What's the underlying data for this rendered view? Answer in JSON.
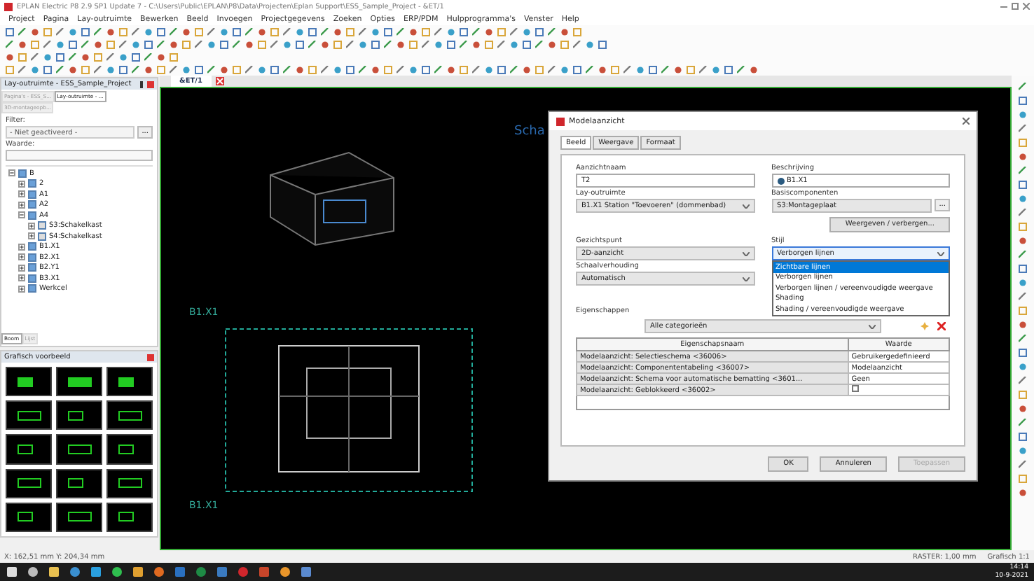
{
  "window": {
    "title": "EPLAN Electric P8 2.9 SP1 Update 7 - C:\\Users\\Public\\EPLAN\\P8\\Data\\Projecten\\Eplan Support\\ESS_Sample_Project - &ET/1"
  },
  "menu": [
    "Project",
    "Pagina",
    "Lay-outruimte",
    "Bewerken",
    "Beeld",
    "Invoegen",
    "Projectgegevens",
    "Zoeken",
    "Opties",
    "ERP/PDM",
    "Hulpprogramma's",
    "Venster",
    "Help"
  ],
  "layout_panel": {
    "title": "Lay-outruimte - ESS_Sample_Project",
    "tabs": [
      {
        "label": "Pagina's - ESS_S...",
        "selected": false
      },
      {
        "label": "Lay-outruimte - ...",
        "selected": true
      },
      {
        "label": "3D-montageopb...",
        "selected": false
      }
    ],
    "filter_label": "Filter:",
    "filter_value": "- Niet geactiveerd -",
    "filter_button": "...",
    "value_label": "Waarde:",
    "tree": [
      {
        "label": "B",
        "expanded": true,
        "children": [
          {
            "label": "2",
            "expanded": false
          },
          {
            "label": "A1",
            "expanded": false
          },
          {
            "label": "A2",
            "expanded": false
          },
          {
            "label": "A4",
            "expanded": true,
            "children": [
              {
                "label": "S3:Schakelkast",
                "expanded": false
              },
              {
                "label": "S4:Schakelkast",
                "expanded": false
              }
            ]
          },
          {
            "label": "B1.X1",
            "expanded": false
          },
          {
            "label": "B2.X1",
            "expanded": false
          },
          {
            "label": "B2.Y1",
            "expanded": false
          },
          {
            "label": "B3.X1",
            "expanded": false
          },
          {
            "label": "Werkcel",
            "expanded": false
          }
        ]
      }
    ],
    "bottom_tabs": [
      {
        "label": "Boom",
        "selected": true
      },
      {
        "label": "Lijst",
        "selected": false
      }
    ]
  },
  "preview_panel": {
    "title": "Grafisch voorbeeld"
  },
  "document_tab": {
    "label": "&ET/1"
  },
  "canvas": {
    "heading": "Scha",
    "marker_top": "B1.X1",
    "marker_bottom": "B1.X1"
  },
  "dialog": {
    "title": "Modelaanzicht",
    "tabs": [
      {
        "label": "Beeld",
        "selected": true
      },
      {
        "label": "Weergave",
        "selected": false
      },
      {
        "label": "Formaat",
        "selected": false
      }
    ],
    "view_name_label": "Aanzichtnaam",
    "view_name": "T2",
    "description_label": "Beschrijving",
    "description": "B1.X1",
    "layout_label": "Lay-outruimte",
    "layout_value": "B1.X1 Station \"Toevoeren\" (dommenbad)",
    "base_label": "Basiscomponenten",
    "base_value": "S3:Montageplaat",
    "base_button": "...",
    "show_hide_button": "Weergeven / verbergen...",
    "viewpoint_label": "Gezichtspunt",
    "viewpoint_value": "2D-aanzicht",
    "style_label": "Stijl",
    "style_value": "Verborgen lijnen",
    "style_options": [
      {
        "label": "Zichtbare lijnen",
        "selected": true
      },
      {
        "label": "Verborgen lijnen",
        "selected": false
      },
      {
        "label": "Verborgen lijnen / vereenvoudigde weergave",
        "selected": false
      },
      {
        "label": "Shading",
        "selected": false
      },
      {
        "label": "Shading / vereenvoudigde weergave",
        "selected": false
      }
    ],
    "scale_label": "Schaalverhouding",
    "scale_value": "Automatisch",
    "properties_label": "Eigenschappen",
    "category": "Alle categorieën",
    "columns": [
      "Eigenschapsnaam",
      "Waarde"
    ],
    "rows": [
      {
        "name": "Modelaanzicht: Selectieschema <36006>",
        "kind": "text",
        "value": "Gebruikergedefinieerd"
      },
      {
        "name": "Modelaanzicht: Componententabeling <36007>",
        "kind": "text",
        "value": "Modelaanzicht"
      },
      {
        "name": "Modelaanzicht: Schema voor automatische bematting <3601...",
        "kind": "text",
        "value": "Geen"
      },
      {
        "name": "Modelaanzicht: Geblokkeerd <36002>",
        "kind": "checkbox",
        "checked": false
      }
    ],
    "buttons": [
      {
        "label": "OK",
        "disabled": false
      },
      {
        "label": "Annuleren",
        "disabled": false
      },
      {
        "label": "Toepassen",
        "disabled": true
      }
    ]
  },
  "status_bar": {
    "coordinates": "X: 162,51 mm  Y: 204,34 mm",
    "grid": "RASTER: 1,00 mm",
    "scale": "Grafisch 1:1"
  },
  "taskbar": {
    "time": "14:14",
    "date": "10-9-2021"
  }
}
